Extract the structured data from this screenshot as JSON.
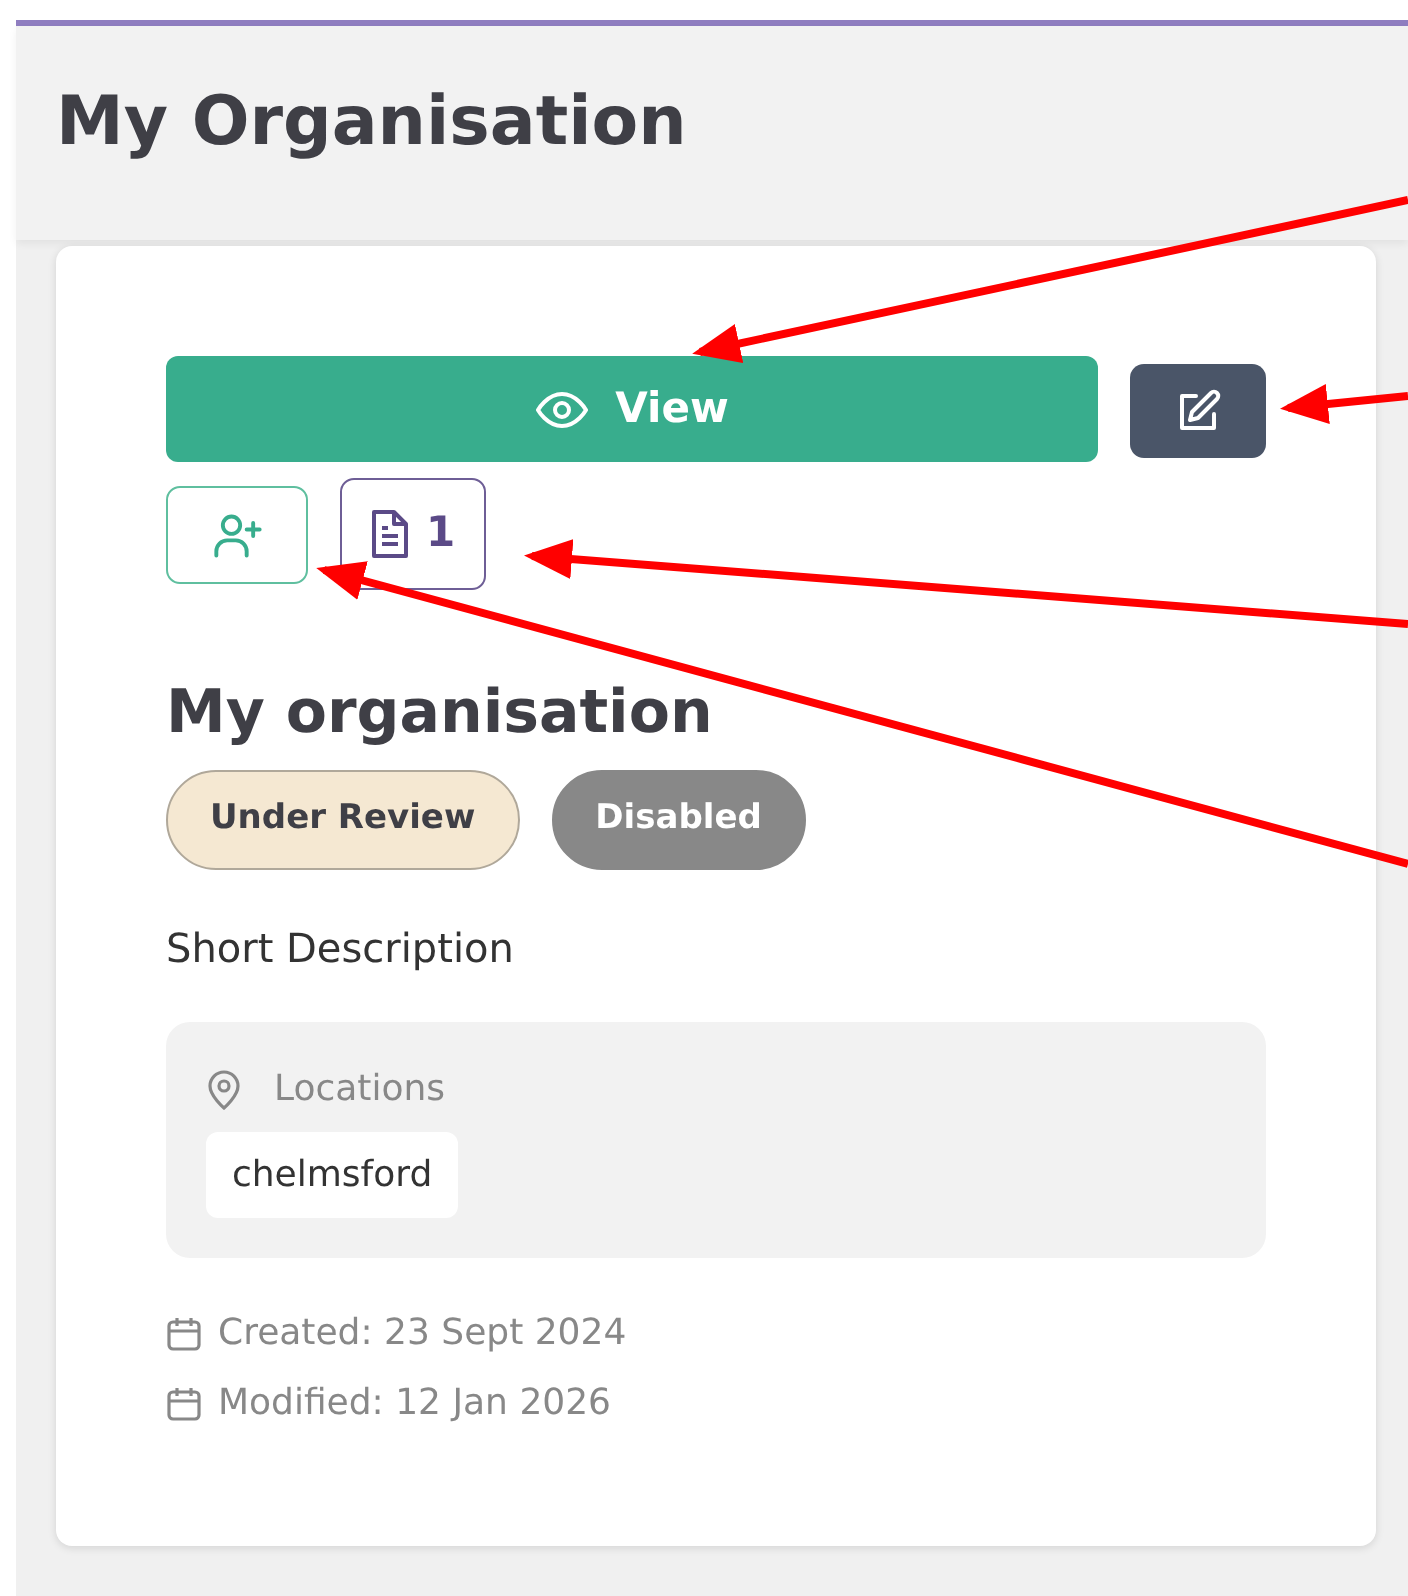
{
  "page": {
    "title": "My Organisation"
  },
  "card": {
    "actions": {
      "view_label": "View",
      "documents_count": "1"
    },
    "name": "My organisation",
    "badges": [
      {
        "label": "Under Review",
        "kind": "review"
      },
      {
        "label": "Disabled",
        "kind": "disabled"
      }
    ],
    "description": "Short Description",
    "locations": {
      "label": "Locations",
      "items": [
        "chelmsford"
      ]
    },
    "dates": [
      {
        "text": "Created: 23 Sept 2024"
      },
      {
        "text": "Modified: 12 Jan 2026"
      }
    ]
  }
}
